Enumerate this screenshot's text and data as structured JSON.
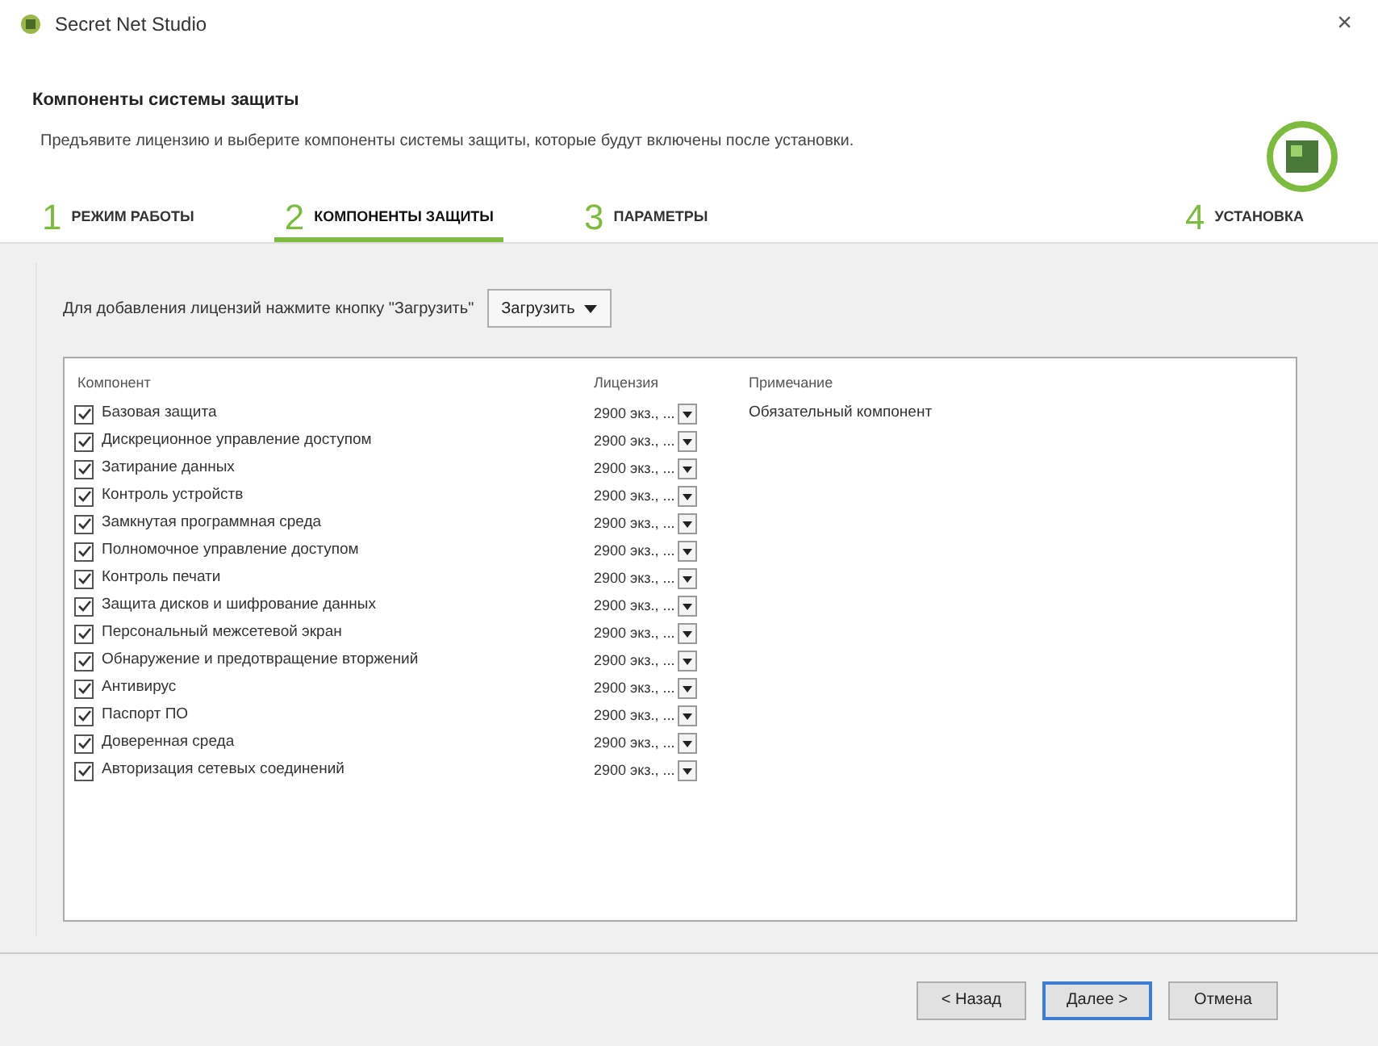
{
  "window": {
    "title": "Secret Net Studio",
    "close": "×"
  },
  "header": {
    "title": "Компоненты системы защиты",
    "description": "Предъявите лицензию и выберите компоненты системы защиты, которые будут включены после установки."
  },
  "steps": [
    {
      "number": "1",
      "label": "РЕЖИМ РАБОТЫ",
      "selected": false
    },
    {
      "number": "2",
      "label": "КОМПОНЕНТЫ ЗАЩИТЫ",
      "selected": true
    },
    {
      "number": "3",
      "label": "ПАРАМЕТРЫ",
      "selected": false
    },
    {
      "number": "4",
      "label": "УСТАНОВКА",
      "selected": false
    }
  ],
  "license_hint": "Для добавления лицензий нажмите кнопку \"Загрузить\"",
  "load_button": "Загрузить",
  "table": {
    "columns": [
      "Компонент",
      "Лицензия",
      "Примечание"
    ],
    "rows": [
      {
        "name": "Базовая защита",
        "checked": true,
        "license": "2900 экз., ...",
        "note": "Обязательный компонент"
      },
      {
        "name": "Дискреционное управление доступом",
        "checked": true,
        "license": "2900 экз., ..."
      },
      {
        "name": "Затирание данных",
        "checked": true,
        "license": "2900 экз., ..."
      },
      {
        "name": "Контроль устройств",
        "checked": true,
        "license": "2900 экз., ..."
      },
      {
        "name": "Замкнутая программная среда",
        "checked": true,
        "license": "2900 экз., ..."
      },
      {
        "name": "Полномочное управление доступом",
        "checked": true,
        "license": "2900 экз., ..."
      },
      {
        "name": "Контроль печати",
        "checked": true,
        "license": "2900 экз., ..."
      },
      {
        "name": "Защита дисков и шифрование данных",
        "checked": true,
        "license": "2900 экз., ..."
      },
      {
        "name": "Персональный межсетевой экран",
        "checked": true,
        "license": "2900 экз., ..."
      },
      {
        "name": "Обнаружение и предотвращение вторжений",
        "checked": true,
        "license": "2900 экз., ..."
      },
      {
        "name": "Антивирус",
        "checked": true,
        "license": "2900 экз., ..."
      },
      {
        "name": "Паспорт ПО",
        "checked": true,
        "license": "2900 экз., ..."
      },
      {
        "name": "Доверенная среда",
        "checked": true,
        "license": "2900 экз., ..."
      },
      {
        "name": "Авторизация сетевых соединений",
        "checked": true,
        "license": "2900 экз., ..."
      }
    ]
  },
  "buttons": [
    {
      "label": "< Назад",
      "kind": "secondary"
    },
    {
      "label": "Далее >",
      "kind": "default"
    },
    {
      "label": "Отмена",
      "kind": "secondary"
    }
  ]
}
